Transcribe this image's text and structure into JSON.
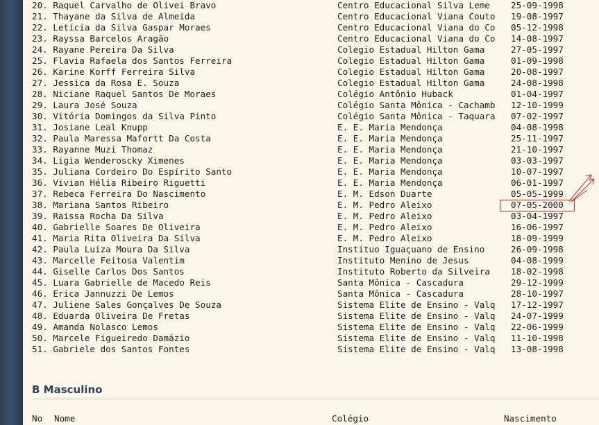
{
  "rows": [
    {
      "name": "20. Raquel Carvalho de Olivei Bravo",
      "school": "Centro Educacional Silva Leme",
      "date": "25-09-1998"
    },
    {
      "name": "21. Thayane da Silva de Almeida",
      "school": "Centro Educacional Viana Couto",
      "date": "19-08-1997"
    },
    {
      "name": "22. Letícia da Silva Gaspar Moraes",
      "school": "Centro Educacional Viana do Co",
      "date": "05-12-1998"
    },
    {
      "name": "23. Rayssa Barcelos Aragão",
      "school": "Centro Educacional Viana do Co",
      "date": "14-08-1997"
    },
    {
      "name": "24. Rayane Pereira Da Silva",
      "school": "Colegio Estadual Hilton Gama",
      "date": "27-05-1997"
    },
    {
      "name": "25. Flavia Rafaela dos Santos Ferreira",
      "school": "Colegio Estadual Hilton Gama",
      "date": "01-09-1998"
    },
    {
      "name": "26. Karine Korff Ferreira Silva",
      "school": "Colegio Estadual Hilton Gama",
      "date": "20-08-1997"
    },
    {
      "name": "27. Jessica da Rosa E. Souza",
      "school": "Colegio Estadual Hilton Gama",
      "date": "24-08-1998"
    },
    {
      "name": "28. Niciane Raquel Santos De Moraes",
      "school": "Colégio Antônio Huback",
      "date": "01-04-1997"
    },
    {
      "name": "29. Laura José Souza",
      "school": "Colégio Santa Mônica - Cachamb",
      "date": "12-10-1999"
    },
    {
      "name": "30. Vitória Domingos da Silva Pinto",
      "school": "Colégio Santa Mônica - Taquara",
      "date": "07-02-1997"
    },
    {
      "name": "31. Josiane Leal Knupp",
      "school": "E. E. Maria Mendonça",
      "date": "04-08-1998"
    },
    {
      "name": "32. Paula Maressa Mafortt Da Costa",
      "school": "E. E. Maria Mendonça",
      "date": "25-11-1997"
    },
    {
      "name": "33. Rayanne Muzi Thomaz",
      "school": "E. E. Maria Mendonça",
      "date": "21-10-1997"
    },
    {
      "name": "34. Ligia Wenderoscky Ximenes",
      "school": "E. E. Maria Mendonça",
      "date": "03-03-1997"
    },
    {
      "name": "35. Juliana Cordeiro Do Espírito Santo",
      "school": "E. E. Maria Mendonça",
      "date": "10-07-1997"
    },
    {
      "name": "36. Vivian Hélia Ribeiro Riguetti",
      "school": "E. E. Maria Mendonça",
      "date": "06-01-1997"
    },
    {
      "name": "37. Rebeca Ferreira Do Nascimento",
      "school": "E. M. Edson Duarte",
      "date": "05-05-1999"
    },
    {
      "name": "38. Mariana Santos Ribeiro",
      "school": "E. M. Pedro Aleixo",
      "date": "07-05-2000"
    },
    {
      "name": "39. Raissa Rocha Da Silva",
      "school": "E. M. Pedro Aleixo",
      "date": "03-04-1997"
    },
    {
      "name": "40. Gabrielle Soares De Oliveira",
      "school": "E. M. Pedro Aleixo",
      "date": "16-06-1997"
    },
    {
      "name": "41. Maria Rita Oliveira Da Silva",
      "school": "E. M. Pedro Aleixo",
      "date": "18-09-1999"
    },
    {
      "name": "42. Paula Luiza Moura Da Silva",
      "school": "Instituo Iguaçuano de Ensino",
      "date": "26-09-1998"
    },
    {
      "name": "43. Marcelle Feitosa Valentim",
      "school": "Instituto Menino de Jesus",
      "date": "04-08-1999"
    },
    {
      "name": "44. Giselle Carlos Dos Santos",
      "school": "Instituto Roberto da Silveira",
      "date": "18-02-1998"
    },
    {
      "name": "45. Luara Gabrielle de Macedo Reis",
      "school": "Santa Mônica - Cascadura",
      "date": "29-12-1999"
    },
    {
      "name": "46. Erica Jannuzzi De Lemos",
      "school": "Santa Mônica - Cascadura",
      "date": "28-10-1997"
    },
    {
      "name": "47. Juliene Sales Gonçalves De Souza",
      "school": "Sistema Elite de Ensino - Valq",
      "date": "17-12-1997"
    },
    {
      "name": "48. Eduarda Oliveira De Fretas",
      "school": "Sistema Elite de Ensino - Valq",
      "date": "24-07-1999"
    },
    {
      "name": "49. Amanda Nolasco Lemos",
      "school": "Sistema Elite de Ensino - Valq",
      "date": "22-06-1999"
    },
    {
      "name": "50. Marcele Figueiredo Damázio",
      "school": "Sistema Elite de Ensino - Valq",
      "date": "11-10-1998"
    },
    {
      "name": "51. Gabriele dos Santos Fontes",
      "school": "Sistema Elite de Ensino - Valq",
      "date": "13-08-1998"
    }
  ],
  "section": {
    "title": "B Masculino"
  },
  "headers": {
    "no": "No",
    "name": "Nome",
    "school": "Colégio",
    "date": "Nascimento"
  },
  "colors": {
    "background": "#fbf6ea",
    "sidebar": "#324560",
    "annotation": "#cc2a2a",
    "heading": "#2f4259"
  },
  "annotation": {
    "highlighted_row": "38. Mariana Santos Ribeiro",
    "highlighted_date": "07-05-2000"
  }
}
